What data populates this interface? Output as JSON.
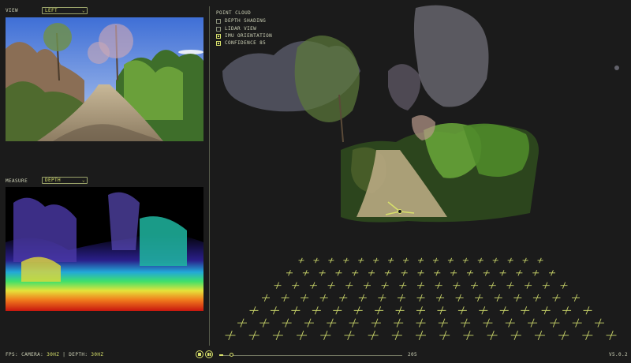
{
  "view": {
    "label": "VIEW",
    "select_value": "LEFT"
  },
  "measure": {
    "label": "MEASURE",
    "select_value": "DEPTH"
  },
  "point_cloud": {
    "title": "POINT CLOUD",
    "options": [
      {
        "label": "DEPTH SHADING",
        "checked": false
      },
      {
        "label": "LIDAR VIEW",
        "checked": false
      },
      {
        "label": "IMU ORIENTATION",
        "checked": true
      },
      {
        "label": "CONFIDENCE 85",
        "checked": true
      }
    ]
  },
  "footer": {
    "fps_label": "FPS:",
    "camera_label": "CAMERA:",
    "camera_value": "30HZ",
    "separator": "|",
    "depth_label": "DEPTH:",
    "depth_value": "30HZ",
    "frame_number": "205",
    "version": "V5.0.2",
    "playback_progress": 0.02
  },
  "colors": {
    "accent": "#d7e06a",
    "background": "#1b1b1b",
    "grid": "#c9d46a"
  }
}
